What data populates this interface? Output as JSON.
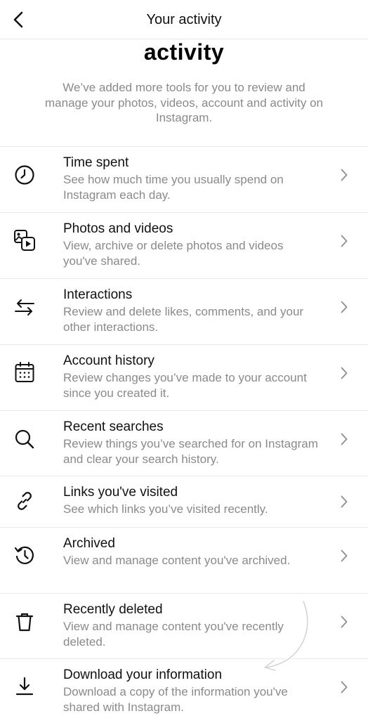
{
  "header": {
    "title": "Your activity",
    "back_icon": "chevron-left-icon"
  },
  "main": {
    "heading": "activity",
    "intro": "We’ve added more tools for you to review and manage your photos, videos, account and activity on Instagram."
  },
  "items": [
    {
      "label": "Time spent",
      "desc": "See how much time you usually spend on Instagram each day.",
      "icon": "clock-icon"
    },
    {
      "label": "Photos and videos",
      "desc": "View, archive or delete photos and videos you've shared.",
      "icon": "photos-videos-icon"
    },
    {
      "label": "Interactions",
      "desc": "Review and delete likes, comments, and your other interactions.",
      "icon": "arrows-swap-icon"
    },
    {
      "label": "Account history",
      "desc": "Review changes you’ve made to your account since you created it.",
      "icon": "calendar-icon"
    },
    {
      "label": "Recent searches",
      "desc": "Review things you’ve searched for on Instagram and clear your search history.",
      "icon": "search-icon"
    },
    {
      "label": "Links you've visited",
      "desc": "See which links you’ve visited recently.",
      "icon": "link-icon"
    },
    {
      "label": "Archived",
      "desc": "View and manage content you've archived.",
      "icon": "archive-history-icon"
    },
    {
      "label": "Recently deleted",
      "desc": "View and manage content you've recently deleted.",
      "icon": "trash-icon"
    },
    {
      "label": "Download your information",
      "desc": "Download a copy of the information you've shared with Instagram.",
      "icon": "download-icon"
    }
  ],
  "colors": {
    "text": "#111111",
    "secondary_text": "#8a8a8a",
    "divider": "#e8e8e8",
    "chevron": "#8e8e8e"
  }
}
